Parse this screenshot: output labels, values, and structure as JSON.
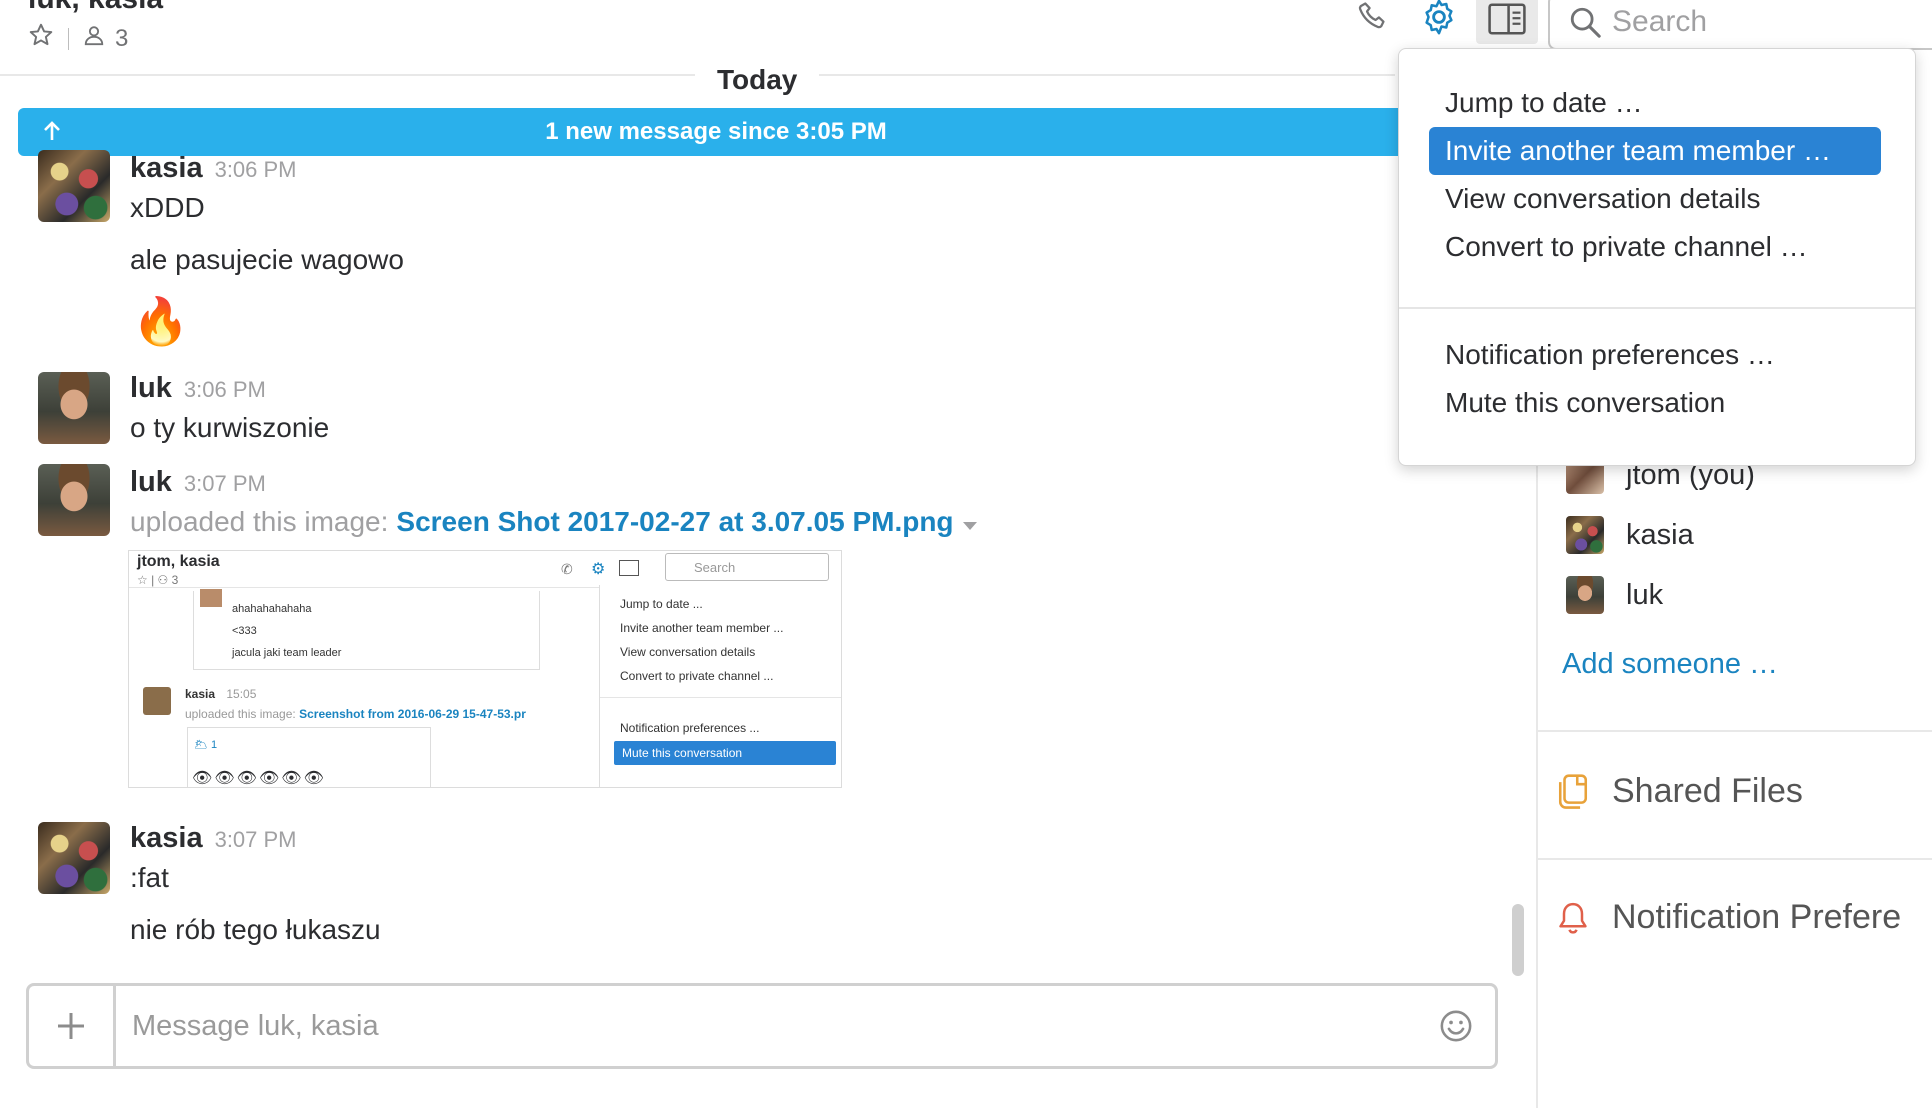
{
  "header": {
    "title": "luk, kasia",
    "member_count": "3",
    "search_placeholder": "Search"
  },
  "feed": {
    "today_label": "Today",
    "new_message_banner": "1 new message since 3:05 PM"
  },
  "messages": [
    {
      "author": "kasia",
      "time": "3:06 PM",
      "lines": [
        "xDDD",
        "ale pasujecie wagowo"
      ],
      "emoji": "🔥"
    },
    {
      "author": "luk",
      "time": "3:06 PM",
      "lines": [
        "o ty kurwiszonie"
      ]
    },
    {
      "author": "luk",
      "time": "3:07 PM",
      "upload_prefix": "uploaded this image:",
      "file_name": "Screen Shot 2017-02-27 at 3.07.05 PM.png"
    },
    {
      "author": "kasia",
      "time": "3:07 PM",
      "lines": [
        ":fat",
        "nie rób tego łukaszu"
      ]
    }
  ],
  "thumbnail": {
    "title": "jtom, kasia",
    "count": "3",
    "search": "Search",
    "lines": [
      "ahahahahahaha",
      "<333",
      "jacula jaki team leader"
    ],
    "author": "kasia",
    "time": "15:05",
    "upload_prefix": "uploaded this image:",
    "file_name": "Screenshot from 2016-06-29 15-47-53.pr",
    "reaction_count": "1",
    "menu": [
      "Jump to date ...",
      "Invite another team member ...",
      "View conversation details",
      "Convert to private channel ...",
      "Notification preferences ...",
      "Mute this conversation"
    ]
  },
  "composer": {
    "placeholder": "Message luk, kasia"
  },
  "sidebar": {
    "members": [
      "jtom (you)",
      "kasia",
      "luk"
    ],
    "add_someone": "Add someone …",
    "shared_files": "Shared Files",
    "notification_prefs": "Notification Prefere"
  },
  "menu": {
    "items": [
      "Jump to date …",
      "Invite another team member …",
      "View conversation details",
      "Convert to private channel …",
      "Notification preferences …",
      "Mute this conversation"
    ],
    "active_index": 1
  },
  "colors": {
    "accent": "#2a83d4",
    "banner": "#2ab0eb",
    "link": "#1a84c0"
  }
}
